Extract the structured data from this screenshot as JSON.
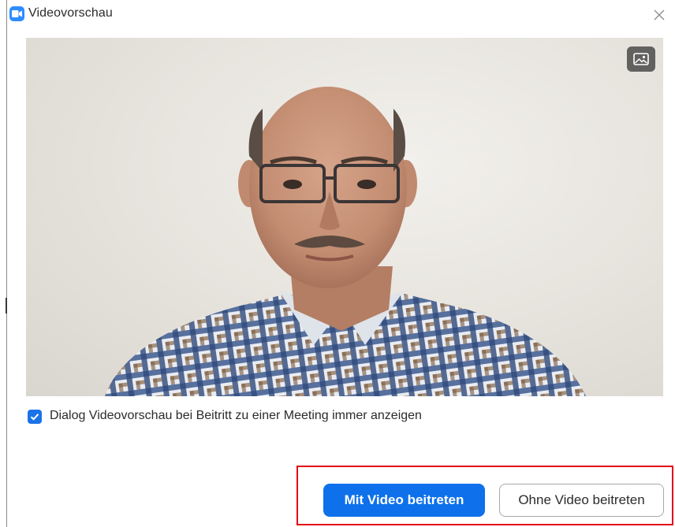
{
  "window": {
    "title": "Videovorschau",
    "app_icon": "zoom-camera-icon",
    "close_icon": "close-icon"
  },
  "video": {
    "background_button_icon": "background-image-icon"
  },
  "preference": {
    "checked": true,
    "label": "Dialog Videovorschau bei Beitritt zu einer Meeting immer anzeigen"
  },
  "actions": {
    "join_with_video_label": "Mit Video beitreten",
    "join_without_video_label": "Ohne Video beitreten"
  },
  "colors": {
    "primary": "#0e71eb",
    "checkbox": "#1a73e8",
    "highlight": "#e30613"
  }
}
